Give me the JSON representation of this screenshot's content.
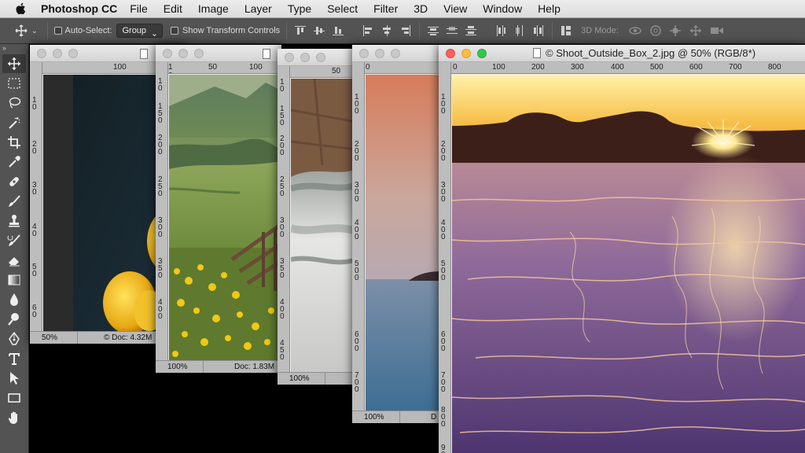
{
  "menubar": {
    "app_name": "Photoshop CC",
    "menus": [
      "File",
      "Edit",
      "Image",
      "Layer",
      "Type",
      "Select",
      "Filter",
      "3D",
      "View",
      "Window",
      "Help"
    ]
  },
  "options_bar": {
    "auto_select_label": "Auto-Select:",
    "auto_select_value": "Group",
    "show_transform_label": "Show Transform Controls",
    "mode_3d_label": "3D Mode:"
  },
  "tools": [
    "move-tool",
    "marquee-tool",
    "lasso-tool",
    "magic-wand-tool",
    "crop-tool",
    "eyedropper-tool",
    "healing-brush-tool",
    "brush-tool",
    "clone-stamp-tool",
    "history-brush-tool",
    "eraser-tool",
    "gradient-tool",
    "blur-tool",
    "dodge-tool",
    "pen-tool",
    "type-tool",
    "path-selection-tool",
    "rectangle-tool",
    "hand-tool"
  ],
  "documents": [
    {
      "zoom": "50%",
      "doc": "© Doc: 4.32M",
      "ruler_h": [
        "100"
      ],
      "ruler_v": [
        "1",
        "0",
        "2",
        "0",
        "3",
        "0",
        "4",
        "0",
        "5",
        "0",
        "6",
        "0"
      ]
    },
    {
      "zoom": "100%",
      "doc": "Doc: 1.83M",
      "ruler_h": [
        "1",
        "0",
        "50",
        "100"
      ],
      "ruler_v": [
        "1",
        "0",
        "1",
        "5",
        "0",
        "2",
        "0",
        "0",
        "2",
        "5",
        "0",
        "3",
        "0",
        "0",
        "3",
        "5",
        "0",
        "4",
        "0",
        "0"
      ]
    },
    {
      "zoom": "100%",
      "doc": "",
      "ruler_h": [
        "50"
      ],
      "ruler_v": [
        "1",
        "0",
        "1",
        "5",
        "0",
        "2",
        "0",
        "0",
        "2",
        "5",
        "0",
        "3",
        "0",
        "0",
        "3",
        "5",
        "0",
        "4",
        "0",
        "0",
        "4",
        "5",
        "0"
      ]
    },
    {
      "zoom": "100%",
      "doc": "D",
      "ruler_h": [
        "0"
      ],
      "ruler_v": [
        "1",
        "0",
        "0",
        "2",
        "0",
        "0",
        "3",
        "0",
        "0",
        "4",
        "0",
        "0",
        "5",
        "0",
        "0",
        "6",
        "0",
        "0",
        "7",
        "0",
        "0"
      ]
    },
    {
      "title": "© Shoot_Outside_Box_2.jpg @ 50% (RGB/8*)",
      "ruler_h": [
        "0",
        "100",
        "200",
        "300",
        "400",
        "500",
        "600",
        "700",
        "800"
      ],
      "ruler_v": [
        "1",
        "0",
        "0",
        "2",
        "0",
        "0",
        "3",
        "0",
        "0",
        "4",
        "0",
        "0",
        "5",
        "0",
        "0",
        "6",
        "0",
        "0",
        "7",
        "0",
        "0",
        "8",
        "0",
        "0",
        "9",
        "0"
      ]
    }
  ],
  "colors": {
    "panel_bg": "#535353",
    "close_red": "#fc605b",
    "minimize_yellow": "#fdbc40",
    "zoom_green": "#34c84a"
  }
}
